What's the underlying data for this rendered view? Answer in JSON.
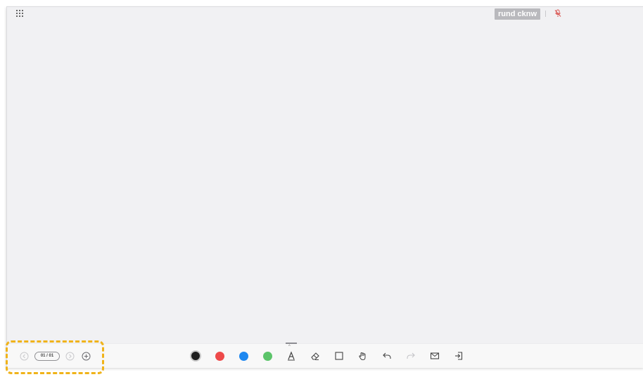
{
  "header": {
    "apps_icon": "grid-icon",
    "user_name": "rund cknw",
    "mic_icon": "microphone-muted-icon"
  },
  "pager": {
    "page_indicator": "01 / 01",
    "prev_icon": "chevron-left-circle-icon",
    "next_icon": "chevron-right-circle-icon",
    "add_page_icon": "plus-circle-icon"
  },
  "toolbar": {
    "colors": [
      {
        "name": "black",
        "hex": "#1d1d1d",
        "selected": true
      },
      {
        "name": "red",
        "hex": "#ee4a4a",
        "selected": false
      },
      {
        "name": "blue",
        "hex": "#1e88f0",
        "selected": false
      },
      {
        "name": "green",
        "hex": "#5cc46a",
        "selected": false
      }
    ],
    "tools": [
      "marker-icon",
      "eraser-icon",
      "rectangle-icon",
      "hand-pan-icon",
      "undo-icon",
      "redo-icon",
      "mail-icon",
      "exit-icon"
    ]
  },
  "colors": {
    "canvas": "#f1f1f3",
    "highlight": "#f0b31a",
    "badge": "#b9b9bd"
  }
}
